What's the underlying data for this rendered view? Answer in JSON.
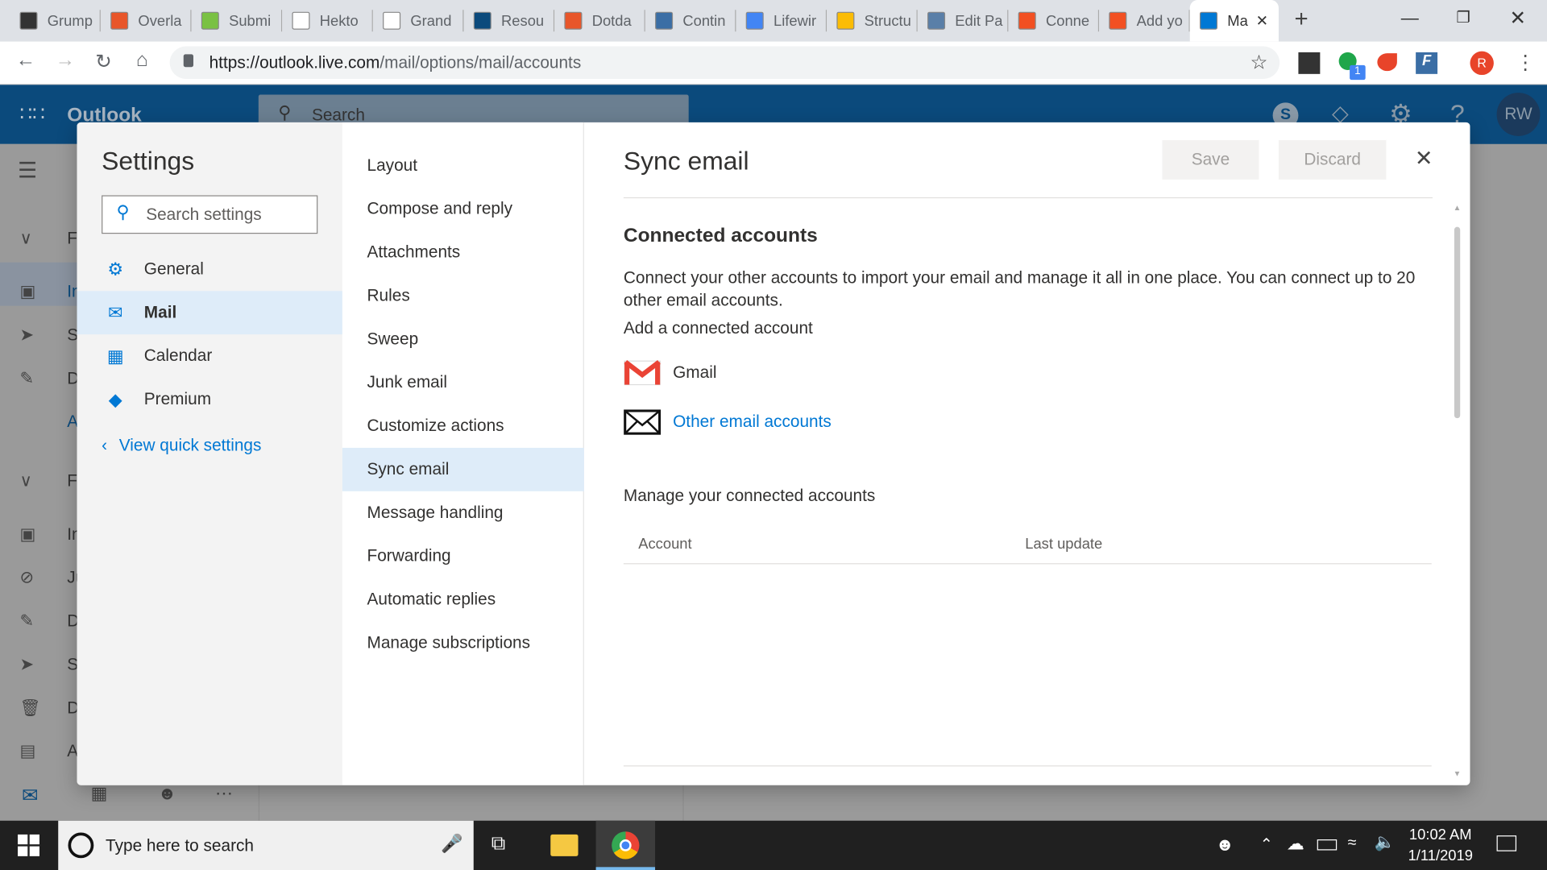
{
  "browser": {
    "tabs": [
      {
        "title": "Grump",
        "color": "#333333"
      },
      {
        "title": "Overla",
        "color": "#e8562a"
      },
      {
        "title": "Submi",
        "color": "#7ac143"
      },
      {
        "title": "Hekto",
        "color": "#ffffff"
      },
      {
        "title": "Grand",
        "color": "#ffffff"
      },
      {
        "title": "Resou",
        "color": "#0b4a7c"
      },
      {
        "title": "Dotda",
        "color": "#e8562a"
      },
      {
        "title": "Contin",
        "color": "#3b6ea5"
      },
      {
        "title": "Lifewir",
        "color": "#4285f4"
      },
      {
        "title": "Structu",
        "color": "#fbbc05"
      },
      {
        "title": "Edit Pa",
        "color": "#5a7fa8"
      },
      {
        "title": "Conne",
        "color": "#f25022"
      },
      {
        "title": "Add yo",
        "color": "#f25022"
      },
      {
        "title": "Ma",
        "color": "#0078d4",
        "active": true
      }
    ],
    "url_host": "https://outlook.live.com",
    "url_path": "/mail/options/mail/accounts",
    "profile_initial": "R",
    "extension_badge": "1"
  },
  "outlook": {
    "brand": "Outlook",
    "search_placeholder": "Search",
    "avatar_initials": "RW",
    "bg_folders": [
      "Fa",
      "In",
      "Se",
      "D",
      "A",
      "Fo",
      "In",
      "Ju",
      "D",
      "Se",
      "D",
      "A"
    ]
  },
  "settings": {
    "title": "Settings",
    "search_placeholder": "Search settings",
    "categories": [
      {
        "label": "General",
        "icon": "gear-icon"
      },
      {
        "label": "Mail",
        "icon": "mail-icon",
        "selected": true
      },
      {
        "label": "Calendar",
        "icon": "calendar-icon"
      },
      {
        "label": "Premium",
        "icon": "diamond-icon"
      }
    ],
    "view_quick_settings": "View quick settings",
    "mail_sections": [
      "Layout",
      "Compose and reply",
      "Attachments",
      "Rules",
      "Sweep",
      "Junk email",
      "Customize actions",
      "Sync email",
      "Message handling",
      "Forwarding",
      "Automatic replies",
      "Manage subscriptions"
    ],
    "selected_section": "Sync email"
  },
  "panel": {
    "title": "Sync email",
    "save": "Save",
    "discard": "Discard",
    "connected_heading": "Connected accounts",
    "description": "Connect your other accounts to import your email and manage it all in one place. You can connect up to 20 other email accounts.",
    "add_label": "Add a connected account",
    "gmail": "Gmail",
    "other": "Other email accounts",
    "manage_label": "Manage your connected accounts",
    "columns": [
      "Account",
      "Last update"
    ],
    "accent": "#0078d4"
  },
  "taskbar": {
    "search_placeholder": "Type here to search",
    "time": "10:02 AM",
    "date": "1/11/2019"
  }
}
